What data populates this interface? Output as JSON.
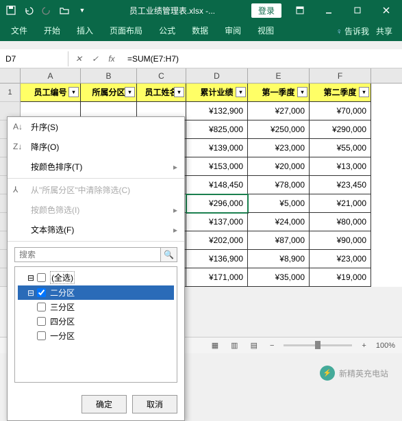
{
  "titlebar": {
    "filename": "员工业绩管理表.xlsx -...",
    "login": "登录"
  },
  "ribbon": {
    "tabs": [
      "文件",
      "开始",
      "插入",
      "页面布局",
      "公式",
      "数据",
      "审阅",
      "视图"
    ],
    "tell_me": "告诉我",
    "share": "共享"
  },
  "formula": {
    "name_box": "D7",
    "fx": "fx",
    "formula": "=SUM(E7:H7)"
  },
  "columns": [
    "A",
    "B",
    "C",
    "D",
    "E",
    "F"
  ],
  "headers": [
    "员工编号",
    "所属分区",
    "员工姓名",
    "累计业绩",
    "第一季度",
    "第二季度"
  ],
  "row_nums": [
    "1"
  ],
  "data_rows": [
    [
      "",
      "",
      "",
      "¥132,900",
      "¥27,000",
      "¥70,000"
    ],
    [
      "",
      "",
      "",
      "¥825,000",
      "¥250,000",
      "¥290,000"
    ],
    [
      "",
      "",
      "",
      "¥139,000",
      "¥23,000",
      "¥55,000"
    ],
    [
      "",
      "",
      "",
      "¥153,000",
      "¥20,000",
      "¥13,000"
    ],
    [
      "",
      "",
      "",
      "¥148,450",
      "¥78,000",
      "¥23,450"
    ],
    [
      "",
      "",
      "",
      "¥296,000",
      "¥5,000",
      "¥21,000"
    ],
    [
      "",
      "",
      "",
      "¥137,000",
      "¥24,000",
      "¥80,000"
    ],
    [
      "",
      "",
      "",
      "¥202,000",
      "¥87,000",
      "¥90,000"
    ],
    [
      "",
      "",
      "",
      "¥136,900",
      "¥8,900",
      "¥23,000"
    ],
    [
      "",
      "",
      "",
      "¥171,000",
      "¥35,000",
      "¥19,000"
    ]
  ],
  "selected_cell": {
    "row": 5,
    "col": 3
  },
  "filter_menu": {
    "sort_asc": "升序(S)",
    "sort_desc": "降序(O)",
    "sort_color": "按颜色排序(T)",
    "clear_filter": "从\"所属分区\"中清除筛选(C)",
    "filter_color": "按颜色筛选(I)",
    "text_filter": "文本筛选(F)",
    "search_placeholder": "搜索",
    "items": [
      {
        "label": "(全选)",
        "checked": false,
        "mixed": true
      },
      {
        "label": "二分区",
        "checked": true,
        "selected": true
      },
      {
        "label": "三分区",
        "checked": false
      },
      {
        "label": "四分区",
        "checked": false
      },
      {
        "label": "一分区",
        "checked": false
      }
    ],
    "ok": "确定",
    "cancel": "取消"
  },
  "statusbar": {
    "zoom": "100%"
  },
  "watermark": "新精英充电站"
}
